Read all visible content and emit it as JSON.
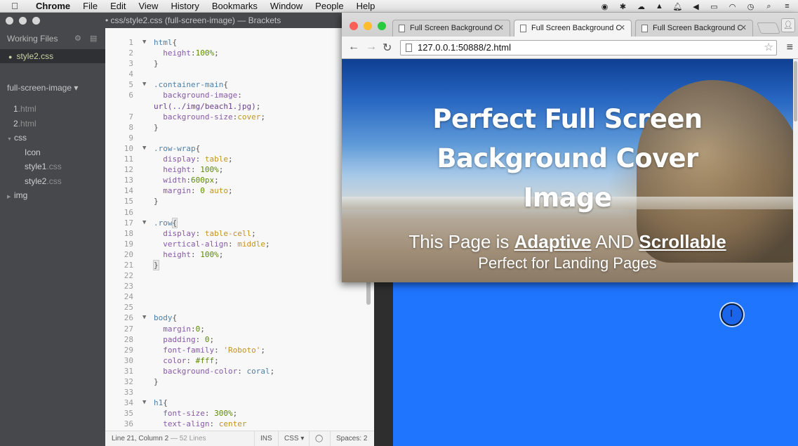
{
  "menubar": {
    "items": [
      "Chrome",
      "File",
      "Edit",
      "View",
      "History",
      "Bookmarks",
      "Window",
      "People",
      "Help"
    ]
  },
  "brackets": {
    "title": "• css/style2.css (full-screen-image) — Brackets",
    "working_files_label": "Working Files",
    "working_file": "style2.css",
    "project_name": "full-screen-image ▾",
    "tree": [
      {
        "name": "1",
        "ext": ".html",
        "indent": 1
      },
      {
        "name": "2",
        "ext": ".html",
        "indent": 1
      },
      {
        "name": "css",
        "ext": "",
        "indent": 0,
        "folder": true,
        "open": true
      },
      {
        "name": "Icon",
        "ext": "",
        "indent": 2
      },
      {
        "name": "style1",
        "ext": ".css",
        "indent": 2
      },
      {
        "name": "style2",
        "ext": ".css",
        "indent": 2
      },
      {
        "name": "img",
        "ext": "",
        "indent": 0,
        "folder": true,
        "open": false
      }
    ],
    "status": {
      "cursor": "Line 21, Column 2",
      "lines": " — 52 Lines",
      "mode": "INS",
      "lang": "CSS ▾",
      "spaces": "Spaces:  2"
    }
  },
  "code_lines": [
    {
      "n": "1",
      "fold": true,
      "html": "<span class='sel'>html</span>{"
    },
    {
      "n": "2",
      "html": "  <span class='prop'>height</span>:<span class='num'>100%</span>;"
    },
    {
      "n": "3",
      "html": "}"
    },
    {
      "n": "4",
      "html": ""
    },
    {
      "n": "5",
      "fold": true,
      "html": "<span class='sel'>.container-main</span>{"
    },
    {
      "n": "6",
      "html": "  <span class='prop'>background-image</span>:"
    },
    {
      "n": "",
      "html": "<span class='url'>url(../img/beach1.jpg)</span>;",
      "wrap": true
    },
    {
      "n": "7",
      "html": "  <span class='prop'>background-size</span>:<span class='kw'>cover</span>;"
    },
    {
      "n": "8",
      "html": "}"
    },
    {
      "n": "9",
      "html": ""
    },
    {
      "n": "10",
      "fold": true,
      "html": "<span class='sel'>.row-wrap</span>{"
    },
    {
      "n": "11",
      "html": "  <span class='prop'>display</span>: <span class='kw'>table</span>;"
    },
    {
      "n": "12",
      "html": "  <span class='prop'>height</span>: <span class='num'>100%</span>;"
    },
    {
      "n": "13",
      "html": "  <span class='prop'>width</span>:<span class='num'>600px</span>;"
    },
    {
      "n": "14",
      "html": "  <span class='prop'>margin</span>: <span class='num'>0</span> <span class='kw'>auto</span>;"
    },
    {
      "n": "15",
      "html": "}"
    },
    {
      "n": "16",
      "html": ""
    },
    {
      "n": "17",
      "fold": true,
      "html": "<span class='sel'>.row</span><span class='br-hl'>{</span>"
    },
    {
      "n": "18",
      "html": "  <span class='prop'>display</span>: <span class='kw'>table-cell</span>;"
    },
    {
      "n": "19",
      "html": "  <span class='prop'>vertical-align</span>: <span class='kw'>middle</span>;"
    },
    {
      "n": "20",
      "html": "  <span class='prop'>height</span>: <span class='num'>100%</span>;"
    },
    {
      "n": "21",
      "html": "<span class='br-hl'>}</span>"
    },
    {
      "n": "22",
      "html": ""
    },
    {
      "n": "23",
      "html": ""
    },
    {
      "n": "24",
      "html": ""
    },
    {
      "n": "25",
      "html": ""
    },
    {
      "n": "26",
      "fold": true,
      "html": "<span class='sel'>body</span>{"
    },
    {
      "n": "27",
      "html": "  <span class='prop'>margin</span>:<span class='num'>0</span>;"
    },
    {
      "n": "28",
      "html": "  <span class='prop'>padding</span>: <span class='num'>0</span>;"
    },
    {
      "n": "29",
      "html": "  <span class='prop'>font-family</span>: <span class='str'>'Roboto'</span>;"
    },
    {
      "n": "30",
      "html": "  <span class='prop'>color</span>: <span class='num'>#fff</span>;"
    },
    {
      "n": "31",
      "html": "  <span class='prop'>background-color</span>: <span class='sel'>coral</span>;"
    },
    {
      "n": "32",
      "html": "}"
    },
    {
      "n": "33",
      "html": ""
    },
    {
      "n": "34",
      "fold": true,
      "html": "<span class='sel'>h1</span>{"
    },
    {
      "n": "35",
      "html": "  <span class='prop'>font-size</span>: <span class='num'>300%</span>;"
    },
    {
      "n": "36",
      "html": "  <span class='prop'>text-align</span>: <span class='kw'>center</span>"
    }
  ],
  "chrome": {
    "tabs": [
      {
        "title": "Full Screen Background C",
        "active": false
      },
      {
        "title": "Full Screen Background C",
        "active": true
      },
      {
        "title": "Full Screen Background C",
        "active": false
      }
    ],
    "url": "127.0.0.1:50888/2.html"
  },
  "page": {
    "headline": "Perfect Full Screen Background Cover Image",
    "sub_pre": "This Page is ",
    "sub_adaptive": "Adaptive",
    "sub_mid": " AND ",
    "sub_scrollable": "Scrollable",
    "sub2": "Perfect for Landing Pages",
    "blue_color": "#1f75fe"
  }
}
